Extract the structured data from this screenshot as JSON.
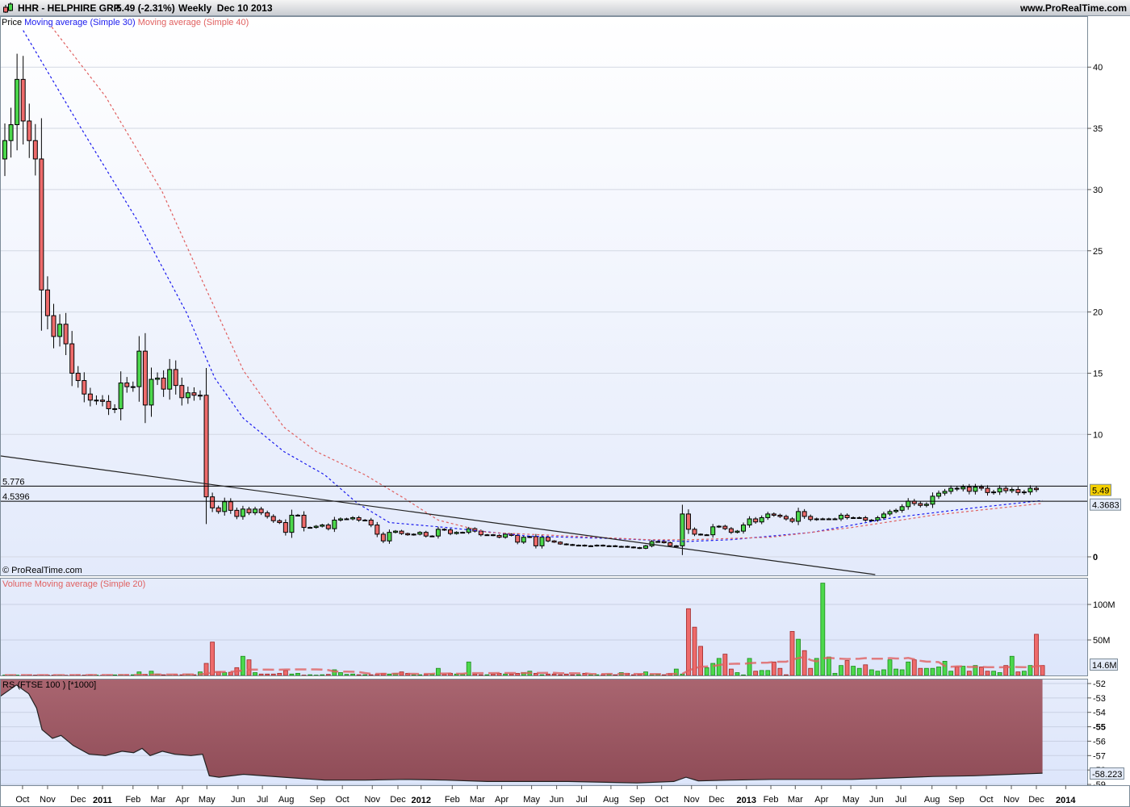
{
  "header": {
    "symbol_title": "HHR - HELPHIRE GRP.",
    "price_change": "5.49 (-2.31%)",
    "period_date": "Weekly  Dec 10 2013",
    "website": "www.ProRealTime.com"
  },
  "legend": {
    "price": "Price",
    "ma30": "Moving average (Simple 30)",
    "ma40": "Moving average (Simple 40)",
    "copyright": "© ProRealTime.com",
    "volume": "Volume",
    "volume_ma": "Moving average (Simple 20)",
    "rs": "RS (FTSE 100 ) [*1000]"
  },
  "colors": {
    "up": "#4cd84c",
    "down": "#ee6b6b",
    "ma30": "#1a1aee",
    "ma40": "#e06060",
    "rs_fill": "#a35c66",
    "marker_yellow": "#f5d000"
  },
  "markers": {
    "last_price": "5.49",
    "ma_value": "4.3683",
    "volume_ma_value": "14.6M",
    "rs_value": "-58.223",
    "hline1_label": "5.776",
    "hline2_label": "4.5396"
  },
  "chart_data": [
    {
      "type": "candlestick",
      "title": "HHR - HELPHIRE GRP. Weekly",
      "x_unit": "week index",
      "ylim": [
        0,
        45
      ],
      "y_ticks": [
        0,
        10,
        15,
        20,
        25,
        30,
        35,
        40
      ],
      "closes": [
        34,
        35.3,
        39,
        35.6,
        34,
        32.5,
        21.8,
        19.7,
        18,
        19,
        17.4,
        15,
        14.4,
        13.3,
        12.8,
        12.8,
        12.7,
        12.1,
        12.1,
        14.2,
        13.9,
        13.9,
        16.8,
        12.4,
        14.5,
        14.6,
        13.7,
        15.3,
        14,
        13,
        13.4,
        13.2,
        13.2,
        4.9,
        4.0,
        3.7,
        4.5,
        3.8,
        3.3,
        3.9,
        3.6,
        3.9,
        3.6,
        3.3,
        2.95,
        2.8,
        2.0,
        3.4,
        3.4,
        2.4,
        2.4,
        2.5,
        2.6,
        2.3,
        3.0,
        3.1,
        3.1,
        3.2,
        3.0,
        3.0,
        2.6,
        1.85,
        1.3,
        2.0,
        2.1,
        1.9,
        1.8,
        1.85,
        2.0,
        1.7,
        1.7,
        2.25,
        2.2,
        1.9,
        2.0,
        2.0,
        2.3,
        2.1,
        1.8,
        1.8,
        1.75,
        1.6,
        1.85,
        1.75,
        1.2,
        1.6,
        1.65,
        0.9,
        1.6,
        1.3,
        1.2,
        1.05,
        1.0,
        0.95,
        0.95,
        0.9,
        0.9,
        0.95,
        0.9,
        0.9,
        0.85,
        0.85,
        0.8,
        0.75,
        0.7,
        0.9,
        1.25,
        1.25,
        1.15,
        0.9,
        0.9,
        3.5,
        2.25,
        1.85,
        1.8,
        1.8,
        2.45,
        2.5,
        2.3,
        2.0,
        2.1,
        2.6,
        3.1,
        2.85,
        3.2,
        3.5,
        3.4,
        3.3,
        3.1,
        2.9,
        3.7,
        3.3,
        3.05,
        3.1,
        3.1,
        3.1,
        3.1,
        3.4,
        3.2,
        3.2,
        3.2,
        3.0,
        3.0,
        3.2,
        3.5,
        3.7,
        3.8,
        4.1,
        4.55,
        4.35,
        4.2,
        4.3,
        4.95,
        5.2,
        5.35,
        5.6,
        5.55,
        5.7,
        5.35,
        5.7,
        5.6,
        5.25,
        5.3,
        5.6,
        5.4,
        5.5,
        5.25,
        5.3,
        5.6,
        5.49
      ],
      "first_open": 32.5,
      "ma30": [
        [
          3,
          43
        ],
        [
          12.5,
          35
        ],
        [
          21.8,
          27.4
        ],
        [
          29.8,
          19.9
        ],
        [
          34.4,
          14.6
        ],
        [
          39.1,
          11.3
        ],
        [
          45.7,
          8.6
        ],
        [
          52.4,
          6.7
        ],
        [
          57.7,
          4.4
        ],
        [
          63,
          2.8
        ],
        [
          72.3,
          2.4
        ],
        [
          85.6,
          1.7
        ],
        [
          98.9,
          1.5
        ],
        [
          111.6,
          1.25
        ],
        [
          118.9,
          1.4
        ],
        [
          132.2,
          2.0
        ],
        [
          145.5,
          3.2
        ],
        [
          158.8,
          4.0
        ],
        [
          170,
          4.6
        ]
      ],
      "ma40": [
        [
          7.2,
          43.6
        ],
        [
          16.5,
          37.6
        ],
        [
          25.8,
          29.8
        ],
        [
          32.4,
          22.5
        ],
        [
          39.1,
          15.2
        ],
        [
          45.7,
          10.6
        ],
        [
          51,
          8.6
        ],
        [
          59,
          6.7
        ],
        [
          65.7,
          4.7
        ],
        [
          71,
          3.0
        ],
        [
          79,
          2.0
        ],
        [
          92.3,
          1.7
        ],
        [
          105.6,
          1.4
        ],
        [
          112.2,
          1.4
        ],
        [
          125.5,
          1.6
        ],
        [
          138.8,
          2.4
        ],
        [
          152.1,
          3.4
        ],
        [
          170,
          4.37
        ]
      ],
      "horizontal_lines": [
        5.776,
        4.5396
      ],
      "trendline": [
        [
          -0.8,
          8.25
        ],
        [
          142.6,
          -1.45
        ]
      ]
    },
    {
      "type": "bar",
      "title": "Volume",
      "y_unit": "M",
      "ylim": [
        0,
        130
      ],
      "y_ticks": [
        {
          "v": 50,
          "label": "50M"
        },
        {
          "v": 100,
          "label": "100M"
        }
      ],
      "values": [
        0.5,
        0.5,
        0.5,
        0.3,
        0.5,
        0.5,
        0.5,
        0.5,
        0.5,
        0.5,
        0.3,
        0.5,
        1,
        0.5,
        1,
        0.5,
        0.3,
        0.5,
        0.8,
        1,
        1,
        1,
        5,
        1.5,
        6,
        2,
        1,
        0.5,
        1,
        1,
        1.5,
        1,
        5,
        17,
        47,
        5,
        4,
        4.5,
        11,
        27,
        22,
        4,
        2,
        2,
        2,
        3,
        7,
        2,
        3,
        0.5,
        1,
        0.5,
        1,
        1.5,
        8,
        4,
        1.5,
        2,
        1,
        1,
        1,
        1.5,
        3,
        2,
        3,
        5,
        3,
        1,
        1,
        1.5,
        2,
        10,
        2,
        3,
        2,
        2,
        19,
        2,
        1,
        1,
        2,
        3,
        2,
        2,
        3,
        4,
        6,
        3,
        1,
        2,
        2,
        1,
        2,
        1,
        1,
        3,
        1,
        1,
        1,
        2,
        1,
        4,
        3,
        1,
        2,
        5,
        1,
        2,
        1,
        3,
        9,
        2,
        94,
        68,
        41,
        11,
        17,
        24,
        30,
        9,
        4,
        0.8,
        24,
        6,
        7,
        7,
        19,
        10,
        1,
        62,
        51,
        35,
        10,
        24,
        130,
        26,
        3,
        14,
        21,
        13,
        10,
        15,
        8,
        6,
        8,
        22,
        9,
        8,
        19,
        22,
        10,
        10,
        10,
        12,
        20,
        6,
        12,
        13,
        6,
        14,
        12,
        6,
        6,
        4,
        14,
        27,
        5,
        6,
        14,
        58,
        14
      ],
      "ma_period": 20
    },
    {
      "type": "area",
      "title": "RS (FTSE 100 ) [*1000]",
      "ylim": [
        -59,
        -52
      ],
      "y_ticks": [
        -52,
        -53,
        -54,
        -55,
        -56,
        -57,
        -58,
        -59
      ],
      "points": [
        [
          -0.8,
          -52.9
        ],
        [
          1.9,
          -52.1
        ],
        [
          3.9,
          -52.7
        ],
        [
          5.2,
          -53.7
        ],
        [
          6.1,
          -55.2
        ],
        [
          7.8,
          -55.8
        ],
        [
          9.2,
          -55.6
        ],
        [
          11.2,
          -56.3
        ],
        [
          13.8,
          -56.9
        ],
        [
          16.5,
          -57.0
        ],
        [
          19.2,
          -56.7
        ],
        [
          21.1,
          -56.8
        ],
        [
          22.5,
          -56.5
        ],
        [
          23.8,
          -57.0
        ],
        [
          25.8,
          -56.7
        ],
        [
          27.8,
          -56.9
        ],
        [
          30.5,
          -57.0
        ],
        [
          32.4,
          -56.9
        ],
        [
          33.5,
          -58.4
        ],
        [
          35.1,
          -58.5
        ],
        [
          39.1,
          -58.3
        ],
        [
          45.7,
          -58.5
        ],
        [
          52.4,
          -58.7
        ],
        [
          59,
          -58.7
        ],
        [
          65.7,
          -58.65
        ],
        [
          72.3,
          -58.7
        ],
        [
          79,
          -58.8
        ],
        [
          92.3,
          -58.8
        ],
        [
          103.6,
          -58.9
        ],
        [
          109.6,
          -58.8
        ],
        [
          111.6,
          -58.5
        ],
        [
          113.6,
          -58.75
        ],
        [
          118.9,
          -58.7
        ],
        [
          125.5,
          -58.65
        ],
        [
          132.2,
          -58.65
        ],
        [
          138.8,
          -58.65
        ],
        [
          145.5,
          -58.55
        ],
        [
          152.1,
          -58.45
        ],
        [
          158.8,
          -58.4
        ],
        [
          170,
          -58.223
        ]
      ]
    }
  ],
  "x_axis": [
    {
      "label": "Oct",
      "week": 2.9
    },
    {
      "label": "Nov",
      "week": 7.0
    },
    {
      "label": "Dec",
      "week": 12
    },
    {
      "label": "2011",
      "week": 16,
      "year": true
    },
    {
      "label": "Feb",
      "week": 21
    },
    {
      "label": "Mar",
      "week": 25.1
    },
    {
      "label": "Apr",
      "week": 29.1
    },
    {
      "label": "May",
      "week": 33.1
    },
    {
      "label": "Jun",
      "week": 38.2
    },
    {
      "label": "Jul",
      "week": 42.2
    },
    {
      "label": "Aug",
      "week": 46.1
    },
    {
      "label": "Sep",
      "week": 51.2
    },
    {
      "label": "Oct",
      "week": 55.3
    },
    {
      "label": "Nov",
      "week": 60.2
    },
    {
      "label": "Dec",
      "week": 64.4
    },
    {
      "label": "2012",
      "week": 68.2,
      "year": true
    },
    {
      "label": "Feb",
      "week": 73.3
    },
    {
      "label": "Mar",
      "week": 77.4
    },
    {
      "label": "Apr",
      "week": 81.4
    },
    {
      "label": "May",
      "week": 86.3
    },
    {
      "label": "Jun",
      "week": 90.4
    },
    {
      "label": "Jul",
      "week": 94.5
    },
    {
      "label": "Aug",
      "week": 99.3
    },
    {
      "label": "Sep",
      "week": 103.6
    },
    {
      "label": "Oct",
      "week": 107.6
    },
    {
      "label": "Nov",
      "week": 112.5
    },
    {
      "label": "Dec",
      "week": 116.6
    },
    {
      "label": "2013",
      "week": 121.5,
      "year": true
    },
    {
      "label": "Feb",
      "week": 125.5
    },
    {
      "label": "Mar",
      "week": 129.5
    },
    {
      "label": "Apr",
      "week": 133.8
    },
    {
      "label": "May",
      "week": 138.6
    },
    {
      "label": "Jun",
      "week": 142.8
    },
    {
      "label": "Jul",
      "week": 146.8
    },
    {
      "label": "Aug",
      "week": 151.9
    },
    {
      "label": "Sep",
      "week": 155.9
    },
    {
      "label": "Oct",
      "week": 160.8
    },
    {
      "label": "Nov",
      "week": 164.9
    },
    {
      "label": "Dec",
      "week": 169
    },
    {
      "label": "2014",
      "week": 173.8,
      "year": true
    }
  ]
}
